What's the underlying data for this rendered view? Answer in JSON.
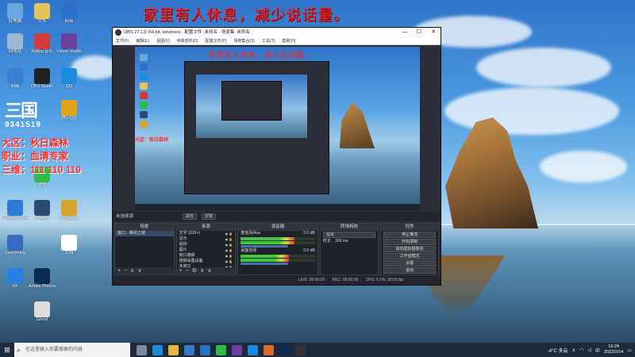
{
  "banner": "家里有人休息，减少说话量。",
  "desktop_icons": [
    {
      "label": "此电脑",
      "color": "#6aa7e0"
    },
    {
      "label": "文件",
      "color": "#e8c35a"
    },
    {
      "label": "网易",
      "color": "#2f6fd1"
    },
    {
      "label": "回收站",
      "color": "#9bb9d6"
    },
    {
      "label": "网易云音乐",
      "color": "#d33a3a"
    },
    {
      "label": "Visual Studio",
      "color": "#6b3fa0"
    },
    {
      "label": "网络",
      "color": "#3a7fd0"
    },
    {
      "label": "OBS Studio",
      "color": "#222222"
    },
    {
      "label": "QQ",
      "color": "#1a8ce0"
    },
    {
      "label": "腾讯QQ",
      "color": "#e0a31a"
    },
    {
      "label": "微信",
      "color": "#2dba4a"
    },
    {
      "label": "GoogleChrome",
      "color": "#2e7bd6"
    },
    {
      "label": "Steam",
      "color": "#2a4a72"
    },
    {
      "label": "WeGame",
      "color": "#d8a32a"
    },
    {
      "label": "文档",
      "color": "#ffffff"
    },
    {
      "label": "Everything",
      "color": "#3a6bc0"
    },
    {
      "label": "Adobe Photoshop",
      "color": "#0b2b55"
    },
    {
      "label": "KK",
      "color": "#2a7fe0"
    },
    {
      "label": "Ghost",
      "color": "#dddddd"
    }
  ],
  "logo3": "三国",
  "logo3_number": "9341519",
  "side_info": {
    "server": "大区：秋日森林",
    "job": "职业：血清专家",
    "id": "三维：111 110 110"
  },
  "obs": {
    "title": "OBS 27.1.3 (64-bit, windows) - 配置文件: 未命名 - 场景集: 未命名",
    "menu": [
      "文件(F)",
      "编辑(E)",
      "视图(V)",
      "停靠部件(D)",
      "配置文件(P)",
      "场景集合(S)",
      "工具(T)",
      "帮助(H)"
    ],
    "preview_banner": "家里有人休息，减少说话量。",
    "source_bar": {
      "label": "未选择源",
      "props": "属性",
      "filters": "滤镜"
    },
    "docks": {
      "scenes": {
        "title": "场景",
        "items": [
          "窗口：腾讯之眼"
        ]
      },
      "sources": {
        "title": "来源",
        "items": [
          "文字 (GDI+)",
          "显示",
          "鼠标",
          "图片",
          "窗口捕获",
          "视频采集设备",
          "多窗口"
        ]
      },
      "mixer": {
        "title": "混音器",
        "channels": [
          {
            "name": "麦克风/Aux",
            "db": "0.0 dB",
            "level": 0.72
          },
          {
            "name": "桌面音频",
            "db": "0.0 dB",
            "level": 0.65
          }
        ]
      },
      "transitions": {
        "title": "转场特效",
        "type": "淡出",
        "duration_label": "时长",
        "duration": "300 ms"
      },
      "controls": {
        "title": "控件",
        "buttons": [
          "停止推流",
          "开始录制",
          "启动虚拟摄像机",
          "工作室模式",
          "设置",
          "退出"
        ]
      }
    },
    "status": {
      "live": "LIVE: 00:00:00",
      "rec": "REC: 00:00:00",
      "cpu": "CPU: 5.1%, 30.00 fps"
    }
  },
  "taskbar": {
    "search_placeholder": "在这里输入你要搜索的内容",
    "weather": "-4°C 多云",
    "lang": "中",
    "time": "19:24",
    "date": "2022/2/14",
    "apps": [
      {
        "name": "task-view",
        "color": "#7a8aa0"
      },
      {
        "name": "edge",
        "color": "#1e88d8"
      },
      {
        "name": "explorer",
        "color": "#e8b83a"
      },
      {
        "name": "store",
        "color": "#3a78c8"
      },
      {
        "name": "mail",
        "color": "#2a6fc0"
      },
      {
        "name": "wechat",
        "color": "#2dba4a"
      },
      {
        "name": "visual-studio",
        "color": "#6b3fa0"
      },
      {
        "name": "qq",
        "color": "#1a8ce0"
      },
      {
        "name": "game",
        "color": "#d86a2a"
      },
      {
        "name": "photoshop",
        "color": "#0b2b55"
      },
      {
        "name": "obs",
        "color": "#333333"
      }
    ]
  }
}
